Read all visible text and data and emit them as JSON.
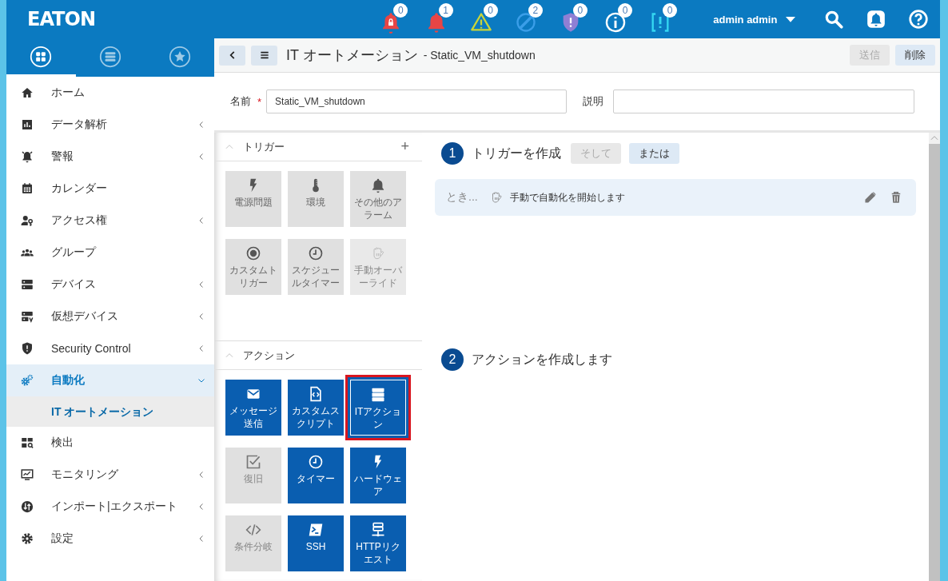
{
  "header": {
    "logo": "EATON",
    "alerts": [
      {
        "kind": "bell-lock",
        "count": "0",
        "color": "#e84545"
      },
      {
        "kind": "bell",
        "count": "1",
        "color": "#e84545"
      },
      {
        "kind": "warning",
        "count": "0",
        "color": "#c9d43a"
      },
      {
        "kind": "blocked",
        "count": "2",
        "color": "#3a9ee8"
      },
      {
        "kind": "shield",
        "count": "0",
        "color": "#8f7fd4"
      },
      {
        "kind": "info",
        "count": "0",
        "color": "#ffffff"
      },
      {
        "kind": "bracket",
        "count": "0",
        "color": "#35d8f2"
      }
    ],
    "user": "admin admin",
    "tools": [
      {
        "kind": "search"
      },
      {
        "kind": "notifications"
      },
      {
        "kind": "help"
      }
    ]
  },
  "sidebar": {
    "tabs": [
      {
        "kind": "grid",
        "selected": true
      },
      {
        "kind": "list",
        "selected": false
      },
      {
        "kind": "star",
        "selected": false
      }
    ],
    "items": [
      {
        "kind": "home",
        "label": "ホーム",
        "expandable": false,
        "selected": false
      },
      {
        "kind": "chart",
        "label": "データ解析",
        "expandable": true,
        "expanded": false,
        "selected": false
      },
      {
        "kind": "alarm",
        "label": "警報",
        "expandable": true,
        "expanded": false,
        "selected": false
      },
      {
        "kind": "calendar",
        "label": "カレンダー",
        "expandable": false,
        "selected": false
      },
      {
        "kind": "user-key",
        "label": "アクセス権",
        "expandable": true,
        "expanded": false,
        "selected": false
      },
      {
        "kind": "group",
        "label": "グループ",
        "expandable": false,
        "selected": false
      },
      {
        "kind": "server",
        "label": "デバイス",
        "expandable": true,
        "expanded": false,
        "selected": false
      },
      {
        "kind": "vserver",
        "label": "仮想デバイス",
        "expandable": true,
        "expanded": false,
        "selected": false
      },
      {
        "kind": "shield",
        "label": "Security Control",
        "expandable": true,
        "expanded": false,
        "selected": false
      },
      {
        "kind": "gears",
        "label": "自動化",
        "expandable": true,
        "expanded": true,
        "selected": true,
        "children": [
          {
            "label": "IT オートメーション",
            "selected": true
          }
        ]
      },
      {
        "kind": "discover",
        "label": "検出",
        "expandable": false,
        "selected": false
      },
      {
        "kind": "monitor",
        "label": "モニタリング",
        "expandable": true,
        "expanded": false,
        "selected": false
      },
      {
        "kind": "transfer",
        "label": "インポート|エクスポート",
        "expandable": true,
        "expanded": false,
        "selected": false
      },
      {
        "kind": "gear",
        "label": "設定",
        "expandable": true,
        "expanded": false,
        "selected": false
      }
    ]
  },
  "editor": {
    "toolbar": {
      "title": "IT オートメーション",
      "subtitle": "- Static_VM_shutdown",
      "buttons": [
        {
          "label": "送信",
          "disabled": true
        },
        {
          "label": "削除",
          "disabled": false
        }
      ]
    },
    "form": {
      "fields": [
        {
          "label": "名前",
          "required_mark": "*",
          "value": "Static_VM_shutdown"
        },
        {
          "label": "説明"
        }
      ]
    },
    "panels": [
      {
        "kind": "trigger",
        "title": "トリガー",
        "add": "+",
        "tiles": [
          {
            "kind": "bolt",
            "label": "電源問題",
            "disabled": false,
            "selected": false
          },
          {
            "kind": "thermometer",
            "label": "環境",
            "disabled": false,
            "selected": false
          },
          {
            "kind": "bell",
            "label": "その他のアラーム",
            "disabled": false,
            "selected": false
          },
          {
            "kind": "radio",
            "label": "カスタムトリガー",
            "disabled": false,
            "selected": false
          },
          {
            "kind": "clock",
            "label": "スケジュールタイマー",
            "disabled": false,
            "selected": false
          },
          {
            "kind": "hand",
            "label": "手動オーバーライド",
            "disabled": true,
            "selected": false
          }
        ]
      },
      {
        "kind": "action",
        "title": "アクション",
        "tiles": [
          {
            "kind": "mail",
            "label": "メッセージ送信",
            "disabled": false,
            "selected": false
          },
          {
            "kind": "file-code",
            "label": "カスタムスクリプト",
            "disabled": false,
            "selected": false
          },
          {
            "kind": "stack",
            "label": "ITアクション",
            "disabled": false,
            "selected": true
          },
          {
            "kind": "checkbox",
            "label": "復旧",
            "disabled": true,
            "selected": false
          },
          {
            "kind": "clock",
            "label": "タイマー",
            "disabled": false,
            "selected": false
          },
          {
            "kind": "bolt",
            "label": "ハードウェア",
            "disabled": false,
            "selected": false
          },
          {
            "kind": "code",
            "label": "条件分岐",
            "disabled": true,
            "selected": false
          },
          {
            "kind": "terminal",
            "label": "SSH",
            "disabled": false,
            "selected": false
          },
          {
            "kind": "network",
            "label": "HTTPリクエスト",
            "disabled": false,
            "selected": false
          }
        ]
      }
    ],
    "steps": [
      {
        "number": "1",
        "title": "トリガーを作成",
        "buttons": [
          {
            "label": "そして",
            "disabled": true
          },
          {
            "label": "または",
            "disabled": false
          }
        ],
        "rows": [
          {
            "prefix": "とき...",
            "kind": "hand",
            "text": "手動で自動化を開始します"
          }
        ]
      },
      {
        "number": "2",
        "title": "アクションを作成します"
      }
    ]
  }
}
